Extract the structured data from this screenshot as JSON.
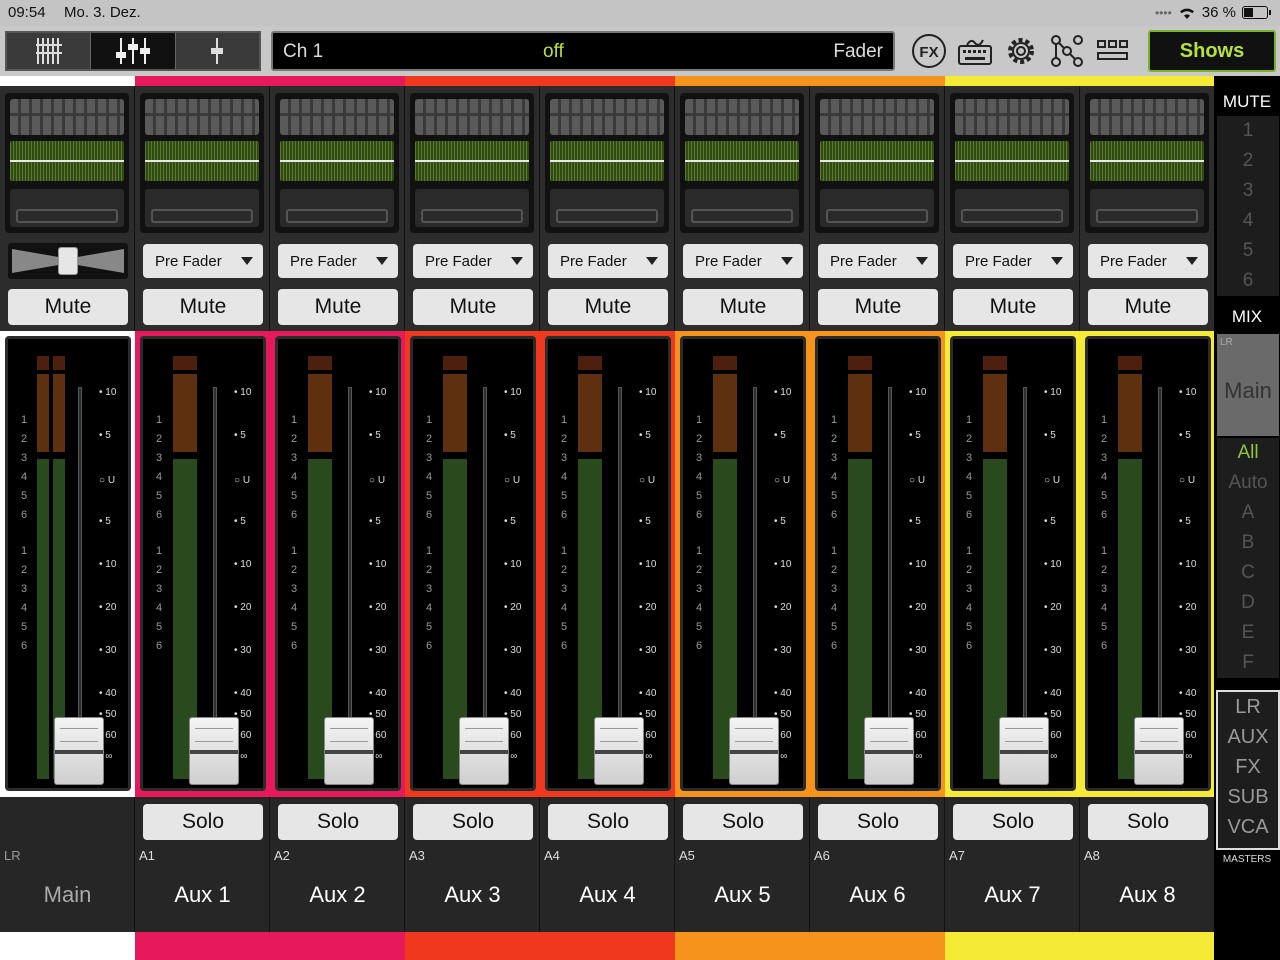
{
  "status": {
    "time": "09:54",
    "date": "Mo. 3. Dez.",
    "battery": "36 %",
    "battery_level": 0.36
  },
  "toolbar": {
    "view_buttons": [
      "mixer-overview-icon",
      "channel-faders-icon",
      "single-fader-icon"
    ],
    "active_view": 1,
    "channel_display": {
      "channel": "Ch 1",
      "state": "off",
      "mode": "Fader"
    },
    "icons": [
      "fx-icon",
      "keyboard-icon",
      "gear-icon",
      "patch-icon",
      "grid-icon"
    ],
    "fx_label": "FX",
    "shows_label": "Shows"
  },
  "colors": {
    "main": "#ffffff",
    "pink": "#e6195d",
    "red": "#f0381e",
    "orange": "#f5931d",
    "yellow": "#f5eb37",
    "accent_green": "#b6e23a"
  },
  "strips": [
    {
      "id": "main",
      "tag": "LR",
      "name": "Main",
      "color": "#ffffff",
      "mute": "Mute",
      "solo": "",
      "send": ""
    },
    {
      "id": "a1",
      "tag": "A1",
      "name": "Aux 1",
      "color": "#e6195d",
      "mute": "Mute",
      "solo": "Solo",
      "send": "Pre Fader"
    },
    {
      "id": "a2",
      "tag": "A2",
      "name": "Aux 2",
      "color": "#e6195d",
      "mute": "Mute",
      "solo": "Solo",
      "send": "Pre Fader"
    },
    {
      "id": "a3",
      "tag": "A3",
      "name": "Aux 3",
      "color": "#f0381e",
      "mute": "Mute",
      "solo": "Solo",
      "send": "Pre Fader"
    },
    {
      "id": "a4",
      "tag": "A4",
      "name": "Aux 4",
      "color": "#f0381e",
      "mute": "Mute",
      "solo": "Solo",
      "send": "Pre Fader"
    },
    {
      "id": "a5",
      "tag": "A5",
      "name": "Aux 5",
      "color": "#f5931d",
      "mute": "Mute",
      "solo": "Solo",
      "send": "Pre Fader"
    },
    {
      "id": "a6",
      "tag": "A6",
      "name": "Aux 6",
      "color": "#f5931d",
      "mute": "Mute",
      "solo": "Solo",
      "send": "Pre Fader"
    },
    {
      "id": "a7",
      "tag": "A7",
      "name": "Aux 7",
      "color": "#f5eb37",
      "mute": "Mute",
      "solo": "Solo",
      "send": "Pre Fader"
    },
    {
      "id": "a8",
      "tag": "A8",
      "name": "Aux 8",
      "color": "#f5eb37",
      "mute": "Mute",
      "solo": "Solo",
      "send": "Pre Fader"
    }
  ],
  "fader_scale": [
    "10",
    "5",
    "U",
    "5",
    "10",
    "20",
    "30",
    "40",
    "50",
    "60",
    "∞"
  ],
  "meter_numbers": [
    "1",
    "2",
    "3",
    "4",
    "5",
    "6",
    "1",
    "2",
    "3",
    "4",
    "5",
    "6"
  ],
  "sidebar": {
    "mute_label": "MUTE",
    "mute_groups": [
      "1",
      "2",
      "3",
      "4",
      "5",
      "6"
    ],
    "mix_label": "MIX",
    "mix_lr": "LR",
    "mix_main": "Main",
    "filters": [
      "All",
      "Auto",
      "A",
      "B",
      "C",
      "D",
      "E",
      "F"
    ],
    "active_filter": "All",
    "masters": [
      "LR",
      "AUX",
      "FX",
      "SUB",
      "VCA"
    ],
    "masters_label": "MASTERS"
  }
}
